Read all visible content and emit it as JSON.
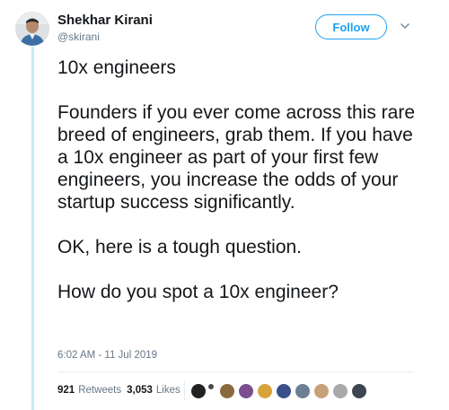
{
  "author": {
    "display_name": "Shekhar Kirani",
    "handle": "@skirani"
  },
  "actions": {
    "follow_label": "Follow"
  },
  "tweet": {
    "paragraphs": [
      "10x engineers",
      "Founders if you ever come across this rare breed of engineers, grab them. If you have a 10x engineer as part of your first few engineers, you increase the odds of your startup success significantly.",
      "OK, here is a tough question.",
      "How do you spot a 10x engineer?"
    ],
    "timestamp": "6:02 AM - 11 Jul 2019"
  },
  "stats": {
    "retweets_count": "921",
    "retweets_label": "Retweets",
    "likes_count": "3,053",
    "likes_label": "Likes"
  },
  "colors": {
    "accent": "#1da1f2",
    "thread_line": "#c6eaf9",
    "secondary_text": "#657786",
    "liker_avatars": [
      "#222222",
      "#4a4a4a",
      "#8a6a3c",
      "#7b4f8f",
      "#d8a43a",
      "#3a4f8a",
      "#6b7f95",
      "#c7a07a",
      "#a9a9a9",
      "#3d4650"
    ]
  }
}
